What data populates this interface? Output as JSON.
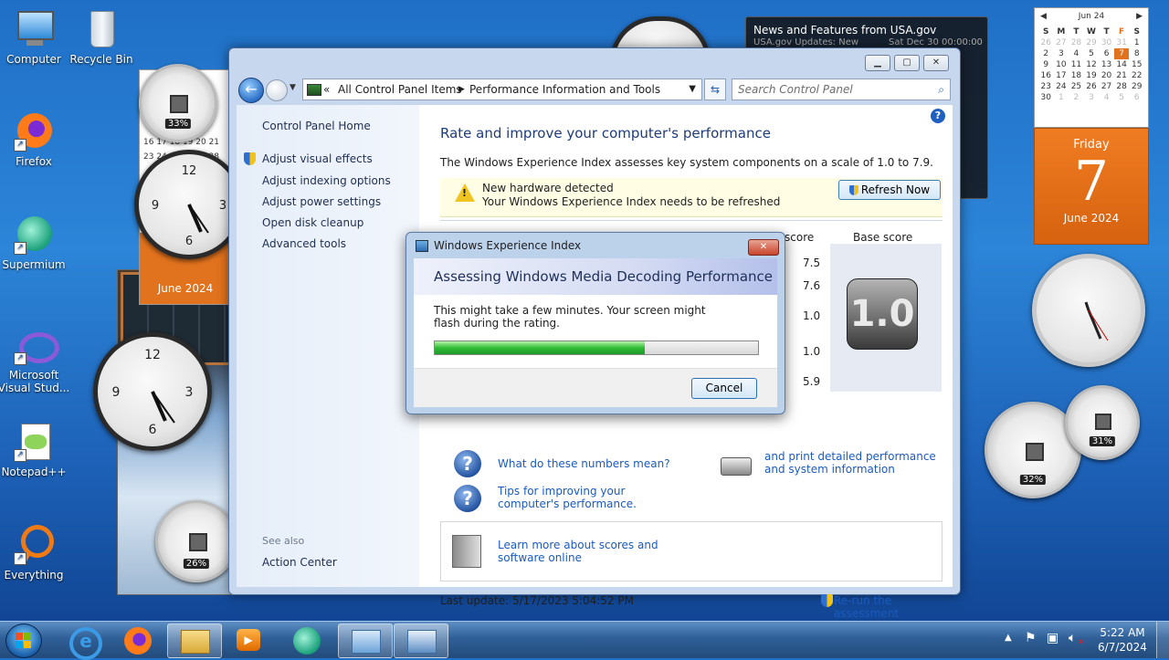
{
  "desktop": {
    "icons": [
      {
        "label": "Computer"
      },
      {
        "label": "Recycle Bin"
      },
      {
        "label": "Firefox"
      },
      {
        "label": "Supermium"
      },
      {
        "label": "Microsoft Visual Stud..."
      },
      {
        "label": "Notepad++"
      },
      {
        "label": "Everything"
      }
    ]
  },
  "gadgets": {
    "meters": [
      "33%",
      "26%",
      "32%",
      "31%"
    ],
    "left_calendar": {
      "month_year": "June 2024",
      "partial_rows": [
        "16 17 18 19 20 21",
        "23 24 25 26 27 28"
      ]
    },
    "news": {
      "title": "News and Features from USA.gov",
      "item_title": "USA.gov Updates: New",
      "item_date": "Sat Dec 30 00:00:00"
    },
    "calendar": {
      "month_label": "Jun 24",
      "day_headers": [
        "S",
        "M",
        "T",
        "W",
        "T",
        "F",
        "S"
      ],
      "days": [
        "26",
        "27",
        "28",
        "29",
        "30",
        "31",
        "1",
        "2",
        "3",
        "4",
        "5",
        "6",
        "7",
        "8",
        "9",
        "10",
        "11",
        "12",
        "13",
        "14",
        "15",
        "16",
        "17",
        "18",
        "19",
        "20",
        "21",
        "22",
        "23",
        "24",
        "25",
        "26",
        "27",
        "28",
        "29",
        "30",
        "1",
        "2",
        "3",
        "4",
        "5",
        "6"
      ],
      "weekday": "Friday",
      "day": "7",
      "month_year": "June 2024"
    }
  },
  "window": {
    "breadcrumb": {
      "root": "All Control Panel Items",
      "current": "Performance Information and Tools"
    },
    "search_placeholder": "Search Control Panel",
    "left_links": [
      "Control Panel Home",
      "Adjust visual effects",
      "Adjust indexing options",
      "Adjust power settings",
      "Open disk cleanup",
      "Advanced tools"
    ],
    "see_also": "See also",
    "see_also_links": [
      "Action Center"
    ],
    "heading": "Rate and improve your computer's performance",
    "description": "The Windows Experience Index assesses key system components on a scale of 1.0 to 7.9.",
    "notice": {
      "line1": "New hardware detected",
      "line2": "Your Windows Experience Index needs to be refreshed",
      "button": "Refresh Now"
    },
    "table": {
      "col_subscore": "score",
      "col_base": "Base score",
      "subscores": [
        "7.5",
        "7.6",
        "1.0",
        "1.0",
        "5.9"
      ],
      "base_score": "1.0"
    },
    "help_links": [
      {
        "text": "What do these numbers mean?"
      },
      {
        "text": "Tips for improving your computer's performance."
      }
    ],
    "print_link": "and print detailed performance and system information",
    "learn_more": "Learn more about scores and software online",
    "last_update": "Last update: 5/17/2023 5:04:52 PM",
    "rerun": "Re-run the assessment"
  },
  "dialog": {
    "title": "Windows Experience Index",
    "heading": "Assessing Windows Media Decoding Performance",
    "body": "This might take a few minutes. Your screen might flash during the rating.",
    "progress": 0.65,
    "cancel": "Cancel"
  },
  "taskbar": {
    "time": "5:22 AM",
    "date": "6/7/2024"
  }
}
